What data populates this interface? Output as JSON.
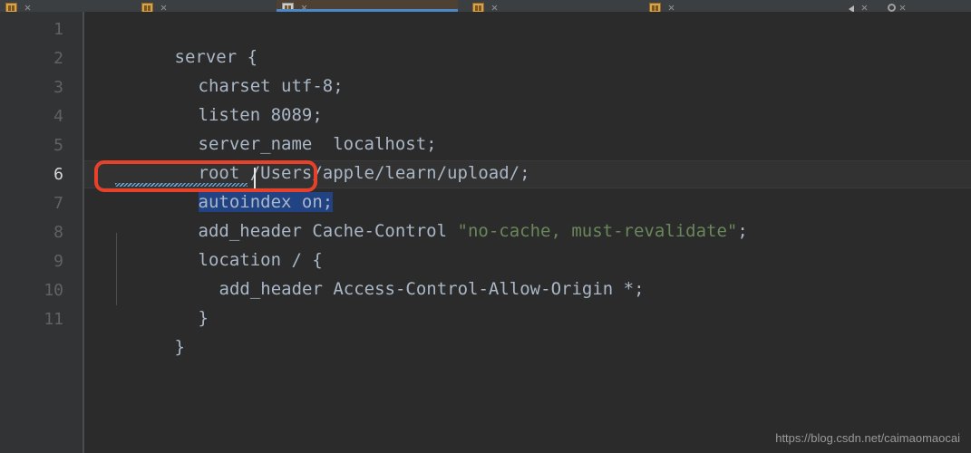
{
  "window": {
    "background_color": "#2b2b2b",
    "gutter_color": "#313335",
    "accent_color": "#4a88c7",
    "annotation_color": "#e8412a",
    "selection_color": "#214283",
    "string_color": "#6a8759",
    "text_color": "#a9b7c6"
  },
  "tabstrip": {
    "tabs": [
      {
        "label": "",
        "icon": "file-icon",
        "state": "normal"
      },
      {
        "label": "",
        "icon": "file-icon",
        "state": "normal"
      },
      {
        "label": "",
        "icon": "file-icon",
        "state": "active"
      },
      {
        "label": "",
        "icon": "file-icon",
        "state": "normal"
      },
      {
        "label": "",
        "icon": "file-icon",
        "state": "normal"
      }
    ],
    "right_icons": [
      {
        "name": "speaker-icon"
      },
      {
        "name": "gear-icon"
      }
    ]
  },
  "editor": {
    "language": "nginx",
    "line_numbers": [
      "1",
      "2",
      "3",
      "4",
      "5",
      "6",
      "7",
      "8",
      "9",
      "10",
      "11"
    ],
    "current_line": 6,
    "cursor": {
      "line": 6,
      "column": 17
    },
    "selection": {
      "line": 6,
      "text": "autoindex on;"
    },
    "lines": [
      {
        "n": 1,
        "indent": 0,
        "segments": [
          {
            "t": "server {",
            "k": "plain"
          }
        ]
      },
      {
        "n": 2,
        "indent": 1,
        "segments": [
          {
            "t": "charset utf-8;",
            "k": "plain"
          }
        ]
      },
      {
        "n": 3,
        "indent": 1,
        "segments": [
          {
            "t": "listen 8089;",
            "k": "plain"
          }
        ]
      },
      {
        "n": 4,
        "indent": 1,
        "segments": [
          {
            "t": "server_name  localhost;",
            "k": "plain"
          }
        ]
      },
      {
        "n": 5,
        "indent": 1,
        "segments": [
          {
            "t": "root /Users/apple/learn/upload/;",
            "k": "plain"
          }
        ]
      },
      {
        "n": 6,
        "indent": 1,
        "segments": [
          {
            "t": "autoindex on;",
            "k": "selected"
          }
        ]
      },
      {
        "n": 7,
        "indent": 1,
        "segments": [
          {
            "t": "add_header Cache-Control ",
            "k": "plain"
          },
          {
            "t": "\"no-cache, must-revalidate\"",
            "k": "string"
          },
          {
            "t": ";",
            "k": "plain"
          }
        ]
      },
      {
        "n": 8,
        "indent": 1,
        "segments": [
          {
            "t": "location / {",
            "k": "plain"
          }
        ]
      },
      {
        "n": 9,
        "indent": 2,
        "segments": [
          {
            "t": "add_header Access-Control-Allow-Origin *;",
            "k": "plain"
          }
        ]
      },
      {
        "n": 10,
        "indent": 1,
        "segments": [
          {
            "t": "}",
            "k": "plain"
          }
        ]
      },
      {
        "n": 11,
        "indent": 0,
        "segments": [
          {
            "t": "}",
            "k": "plain"
          }
        ]
      }
    ]
  },
  "annotation": {
    "shape": "rounded-rectangle",
    "target_line": 6,
    "target_text": "autoindex on;"
  },
  "watermark": {
    "text": "https://blog.csdn.net/caimaomaocai"
  }
}
